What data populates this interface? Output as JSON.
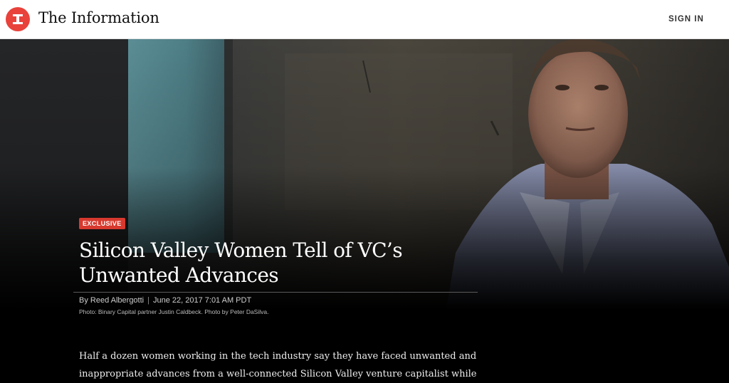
{
  "header": {
    "site_title": "The Information",
    "sign_in_label": "SIGN IN",
    "logo_icon": "information-logo-icon",
    "accent_color": "#e8423b"
  },
  "article": {
    "badge": "EXCLUSIVE",
    "headline": "Silicon Valley Women Tell of VC’s Unwanted Advances",
    "byline_author": "By Reed Albergotti",
    "byline_separator": "|",
    "byline_date": "June 22, 2017 7:01 AM PDT",
    "photo_caption": "Photo: Binary Capital partner Justin Caldbeck. Photo by Peter DaSilva.",
    "body_lines": [
      "Half a dozen women working in the tech industry say they have faced unwanted and",
      "inappropriate advances from a well-connected Silicon Valley venture capitalist while"
    ],
    "badge_color": "#d8392e"
  }
}
